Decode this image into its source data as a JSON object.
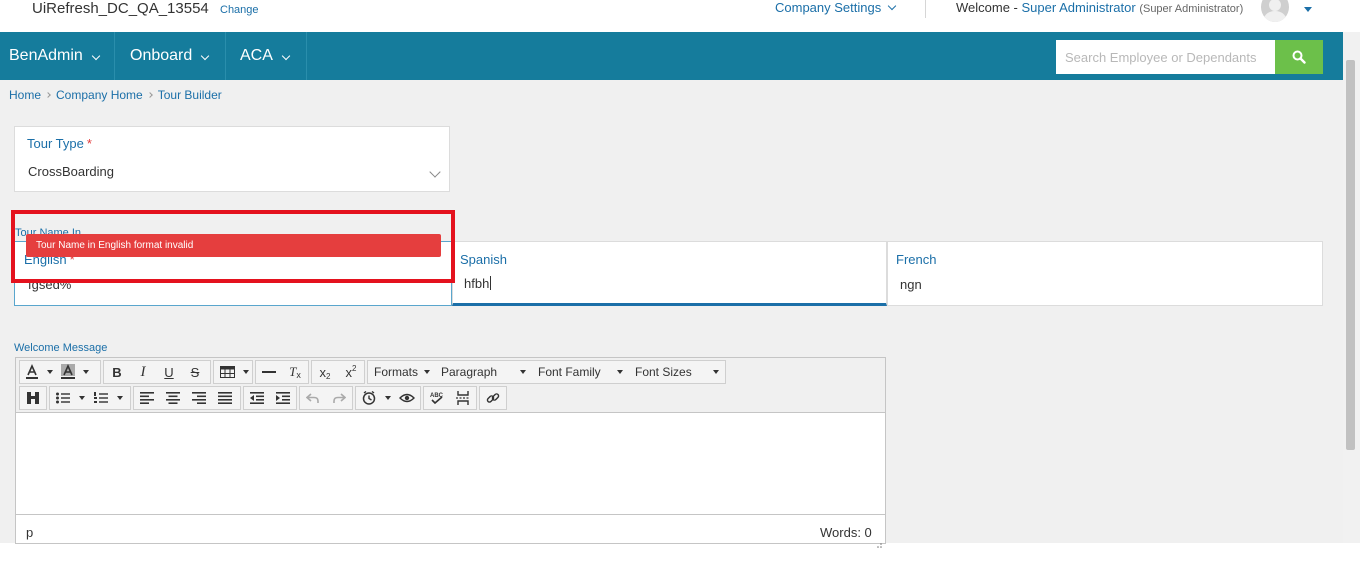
{
  "header": {
    "company_name": "UiRefresh_DC_QA_13554",
    "change_link": "Change",
    "company_settings": "Company Settings",
    "welcome_prefix": "Welcome -",
    "user_name": "Super Administrator",
    "user_role": "(Super Administrator)"
  },
  "nav": {
    "items": [
      {
        "label": "BenAdmin"
      },
      {
        "label": "Onboard"
      },
      {
        "label": "ACA"
      }
    ],
    "search_placeholder": "Search Employee or Dependants",
    "accent_color": "#157c9c",
    "search_button_color": "#6cc04a"
  },
  "breadcrumb": [
    "Home",
    "Company Home",
    "Tour Builder"
  ],
  "form": {
    "tour_type": {
      "label": "Tour Type",
      "required_mark": "*",
      "value": "CrossBoarding"
    },
    "tour_name": {
      "label": "Tour Name In",
      "error_message": "Tour Name in English format invalid",
      "languages": [
        {
          "label": "English",
          "required_mark": "*",
          "value": "fgsed%"
        },
        {
          "label": "Spanish",
          "value": "hfbh"
        },
        {
          "label": "French",
          "value": "ngn"
        }
      ]
    },
    "welcome_message": {
      "label": "Welcome Message",
      "toolbar": {
        "formats": "Formats",
        "paragraph": "Paragraph",
        "font_family": "Font Family",
        "font_sizes": "Font Sizes"
      },
      "status_path": "p",
      "word_count": "Words: 0"
    }
  },
  "error_color": "#e53e3e",
  "highlight_color": "#e4121e"
}
